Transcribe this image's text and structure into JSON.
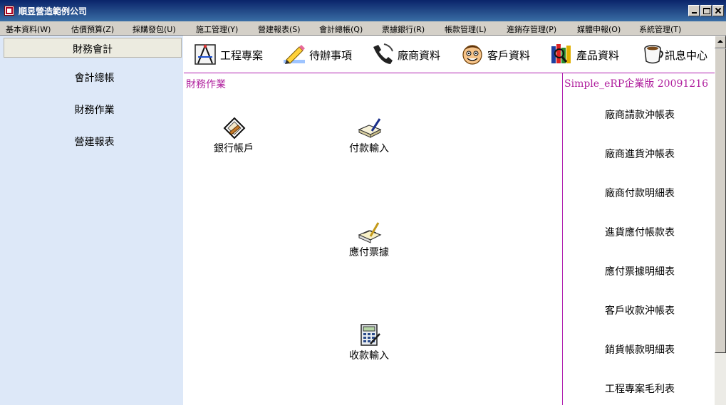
{
  "window": {
    "title": "順昱營造範例公司"
  },
  "menu": [
    "基本資料(W)",
    "估價預算(Z)",
    "採購發包(U)",
    "施工管理(Y)",
    "營建報表(S)",
    "會計總帳(Q)",
    "票據銀行(R)",
    "帳款管理(L)",
    "進銷存管理(P)",
    "媒體申報(O)",
    "系統管理(T)"
  ],
  "sidebar": {
    "header": "財務會計",
    "items": [
      "會計總帳",
      "財務作業",
      "營建報表"
    ]
  },
  "toolbar": [
    {
      "label": "工程專案",
      "icon": "drafting-tools-icon"
    },
    {
      "label": "待辦事項",
      "icon": "pencil-icon"
    },
    {
      "label": "廠商資料",
      "icon": "telephone-icon"
    },
    {
      "label": "客戶資料",
      "icon": "face-icon"
    },
    {
      "label": "產品資料",
      "icon": "books-icon"
    },
    {
      "label": "訊息中心",
      "icon": "coffee-cup-icon"
    }
  ],
  "main": {
    "section_title": "財務作業",
    "items": [
      {
        "label": "銀行帳戶",
        "icon": "bank-sign-icon"
      },
      {
        "label": "付款輸入",
        "icon": "ledger-pen-icon"
      },
      {
        "label": "應付票據",
        "icon": "notes-pen-icon"
      },
      {
        "label": "收款輸入",
        "icon": "calculator-icon"
      }
    ]
  },
  "right_panel": {
    "version": "Simple_eRP企業版 20091216",
    "reports": [
      "廠商請款沖帳表",
      "廠商進貨沖帳表",
      "廠商付款明細表",
      "進貨應付帳款表",
      "應付票據明細表",
      "客戶收款沖帳表",
      "銷貨帳款明細表",
      "工程專案毛利表"
    ]
  },
  "colors": {
    "titlebar": "#0a246a",
    "menubar": "#d4d0c8",
    "sidebar": "#dde8f8",
    "accent": "#b0209e"
  }
}
